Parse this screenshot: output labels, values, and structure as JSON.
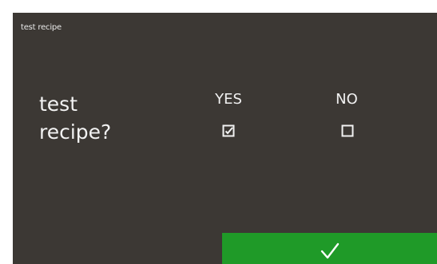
{
  "header": {
    "title": "test recipe"
  },
  "question": {
    "line1": "test",
    "line2": "recipe?"
  },
  "options": [
    {
      "label": "YES",
      "checked": true
    },
    {
      "label": "NO",
      "checked": false
    }
  ],
  "confirm": {
    "icon": "checkmark-icon"
  },
  "colors": {
    "background": "#3c3834",
    "text": "#f2f2f2",
    "confirm_button": "#1f9a28"
  }
}
